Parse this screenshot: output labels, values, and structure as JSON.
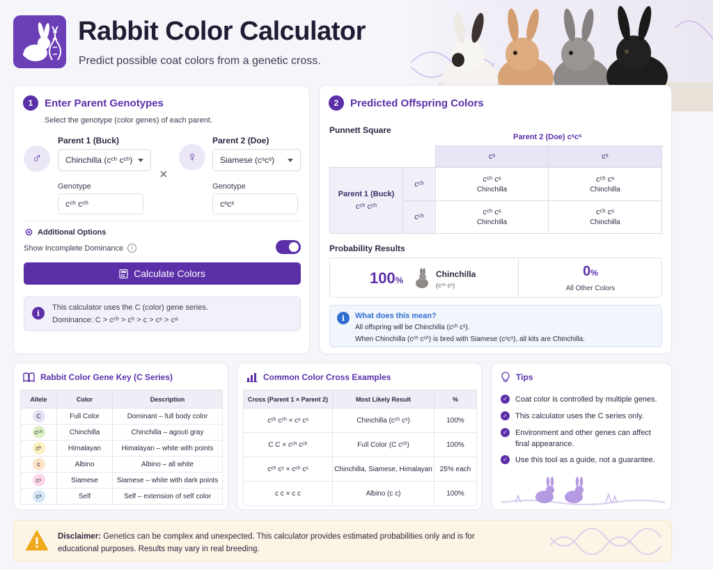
{
  "header": {
    "title": "Rabbit Color Calculator",
    "subtitle": "Predict possible coat colors from a genetic cross."
  },
  "step1": {
    "number": "1",
    "title": "Enter Parent Genotypes",
    "instructions": "Select the genotype (color genes) of each parent.",
    "parent1_label": "Parent 1 (Buck)",
    "parent1_select": "Chinchilla (cᶜʰ cᶜʰ)",
    "parent1_genotype_label": "Genotype",
    "parent1_genotype": "cᶜʰ cᶜʰ",
    "cross_symbol": "×",
    "parent2_label": "Parent 2 (Doe)",
    "parent2_select": "Siamese (cˢcˢ)",
    "parent2_genotype_label": "Genotype",
    "parent2_genotype": "cˢcˢ",
    "options_title": "Additional Options",
    "incomplete_dominance_label": "Show Incomplete Dominance",
    "incomplete_dominance_on": true,
    "calculate_button": "Calculate Colors",
    "info_line1": "This calculator uses the C (color) gene series.",
    "info_line2": "Dominance: C > cᶜʰ > cʰ > c > cˢ > cᵃ"
  },
  "step2": {
    "number": "2",
    "title": "Predicted Offspring Colors",
    "punnett_title": "Punnett Square",
    "parent2_header": "Parent 2 (Doe) cˢcˢ",
    "col_alleles": [
      "cˢ",
      "cˢ"
    ],
    "parent1_header": "Parent 1 (Buck)",
    "parent1_genotype": "cᶜʰ cᶜʰ",
    "row_alleles": [
      "cᶜʰ",
      "cᶜʰ"
    ],
    "cells": [
      [
        {
          "geno": "cᶜʰ cˢ",
          "pheno": "Chinchilla"
        },
        {
          "geno": "cᶜʰ cˢ",
          "pheno": "Chinchilla"
        }
      ],
      [
        {
          "geno": "cᶜʰ cˢ",
          "pheno": "Chinchilla"
        },
        {
          "geno": "cᶜʰ cˢ",
          "pheno": "Chinchilla"
        }
      ]
    ],
    "probability_title": "Probability Results",
    "main_percent": "100",
    "main_percent_unit": "%",
    "main_color": "Chinchilla",
    "main_genotype": "(cᶜʰ cˢ)",
    "other_percent": "0",
    "other_percent_unit": "%",
    "other_label": "All Other Colors",
    "meaning_title": "What does this mean?",
    "meaning_line1": "All offspring will be Chinchilla (cᶜʰ cˢ).",
    "meaning_line2": "When Chinchilla (cᶜʰ cᶜʰ) is bred with Siamese (cˢcˢ), all kits are Chinchilla."
  },
  "gene_key": {
    "title": "Rabbit Color Gene Key (C Series)",
    "headers": [
      "Allele",
      "Color",
      "Description"
    ],
    "rows": [
      {
        "allele": "C",
        "color": "Full Color",
        "desc": "Dominant – full body color",
        "dot": "#e5e0f5"
      },
      {
        "allele": "cᶜʰ",
        "color": "Chinchilla",
        "desc": "Chinchilla – agouti gray",
        "dot": "#dcefc7"
      },
      {
        "allele": "cʰ",
        "color": "Himalayan",
        "desc": "Himalayan – white with points",
        "dot": "#fcefc0"
      },
      {
        "allele": "c",
        "color": "Albino",
        "desc": "Albino – all white",
        "dot": "#fde3c8"
      },
      {
        "allele": "cˢ",
        "color": "Siamese",
        "desc": "Siamese – white with dark points",
        "dot": "#fbd6e8"
      },
      {
        "allele": "cᵃ",
        "color": "Self",
        "desc": "Self – extension of self color",
        "dot": "#d3e6f7"
      }
    ]
  },
  "examples": {
    "title": "Common Color Cross Examples",
    "headers": [
      "Cross (Parent 1 × Parent 2)",
      "Most Likely Result",
      "%"
    ],
    "rows": [
      {
        "cross": "cᶜʰ cᶜʰ  ×  cˢ cˢ",
        "result": "Chinchilla (cᶜʰ cˢ)",
        "pct": "100%"
      },
      {
        "cross": "C C  ×  cᶜʰ cᶜʰ",
        "result": "Full Color (C cᶜʰ)",
        "pct": "100%"
      },
      {
        "cross": "cᶜʰ cˢ  ×  cᶜʰ cˢ",
        "result": "Chinchilla, Siamese, Himalayan",
        "pct": "25% each"
      },
      {
        "cross": "c c  ×  c c",
        "result": "Albino (c c)",
        "pct": "100%"
      }
    ]
  },
  "tips": {
    "title": "Tips",
    "items": [
      "Coat color is controlled by multiple genes.",
      "This calculator uses the C series only.",
      "Environment and other genes can affect final appearance.",
      "Use this tool as a guide, not a guarantee."
    ]
  },
  "disclaimer": {
    "bold": "Disclaimer:",
    "text": " Genetics can be complex and unexpected. This calculator provides estimated probabilities only and is for educational purposes. Results may vary in real breeding."
  },
  "colors": {
    "accent": "#5b2fa8",
    "accent_light": "#ece7f7",
    "info_blue": "#2f6fd1"
  }
}
